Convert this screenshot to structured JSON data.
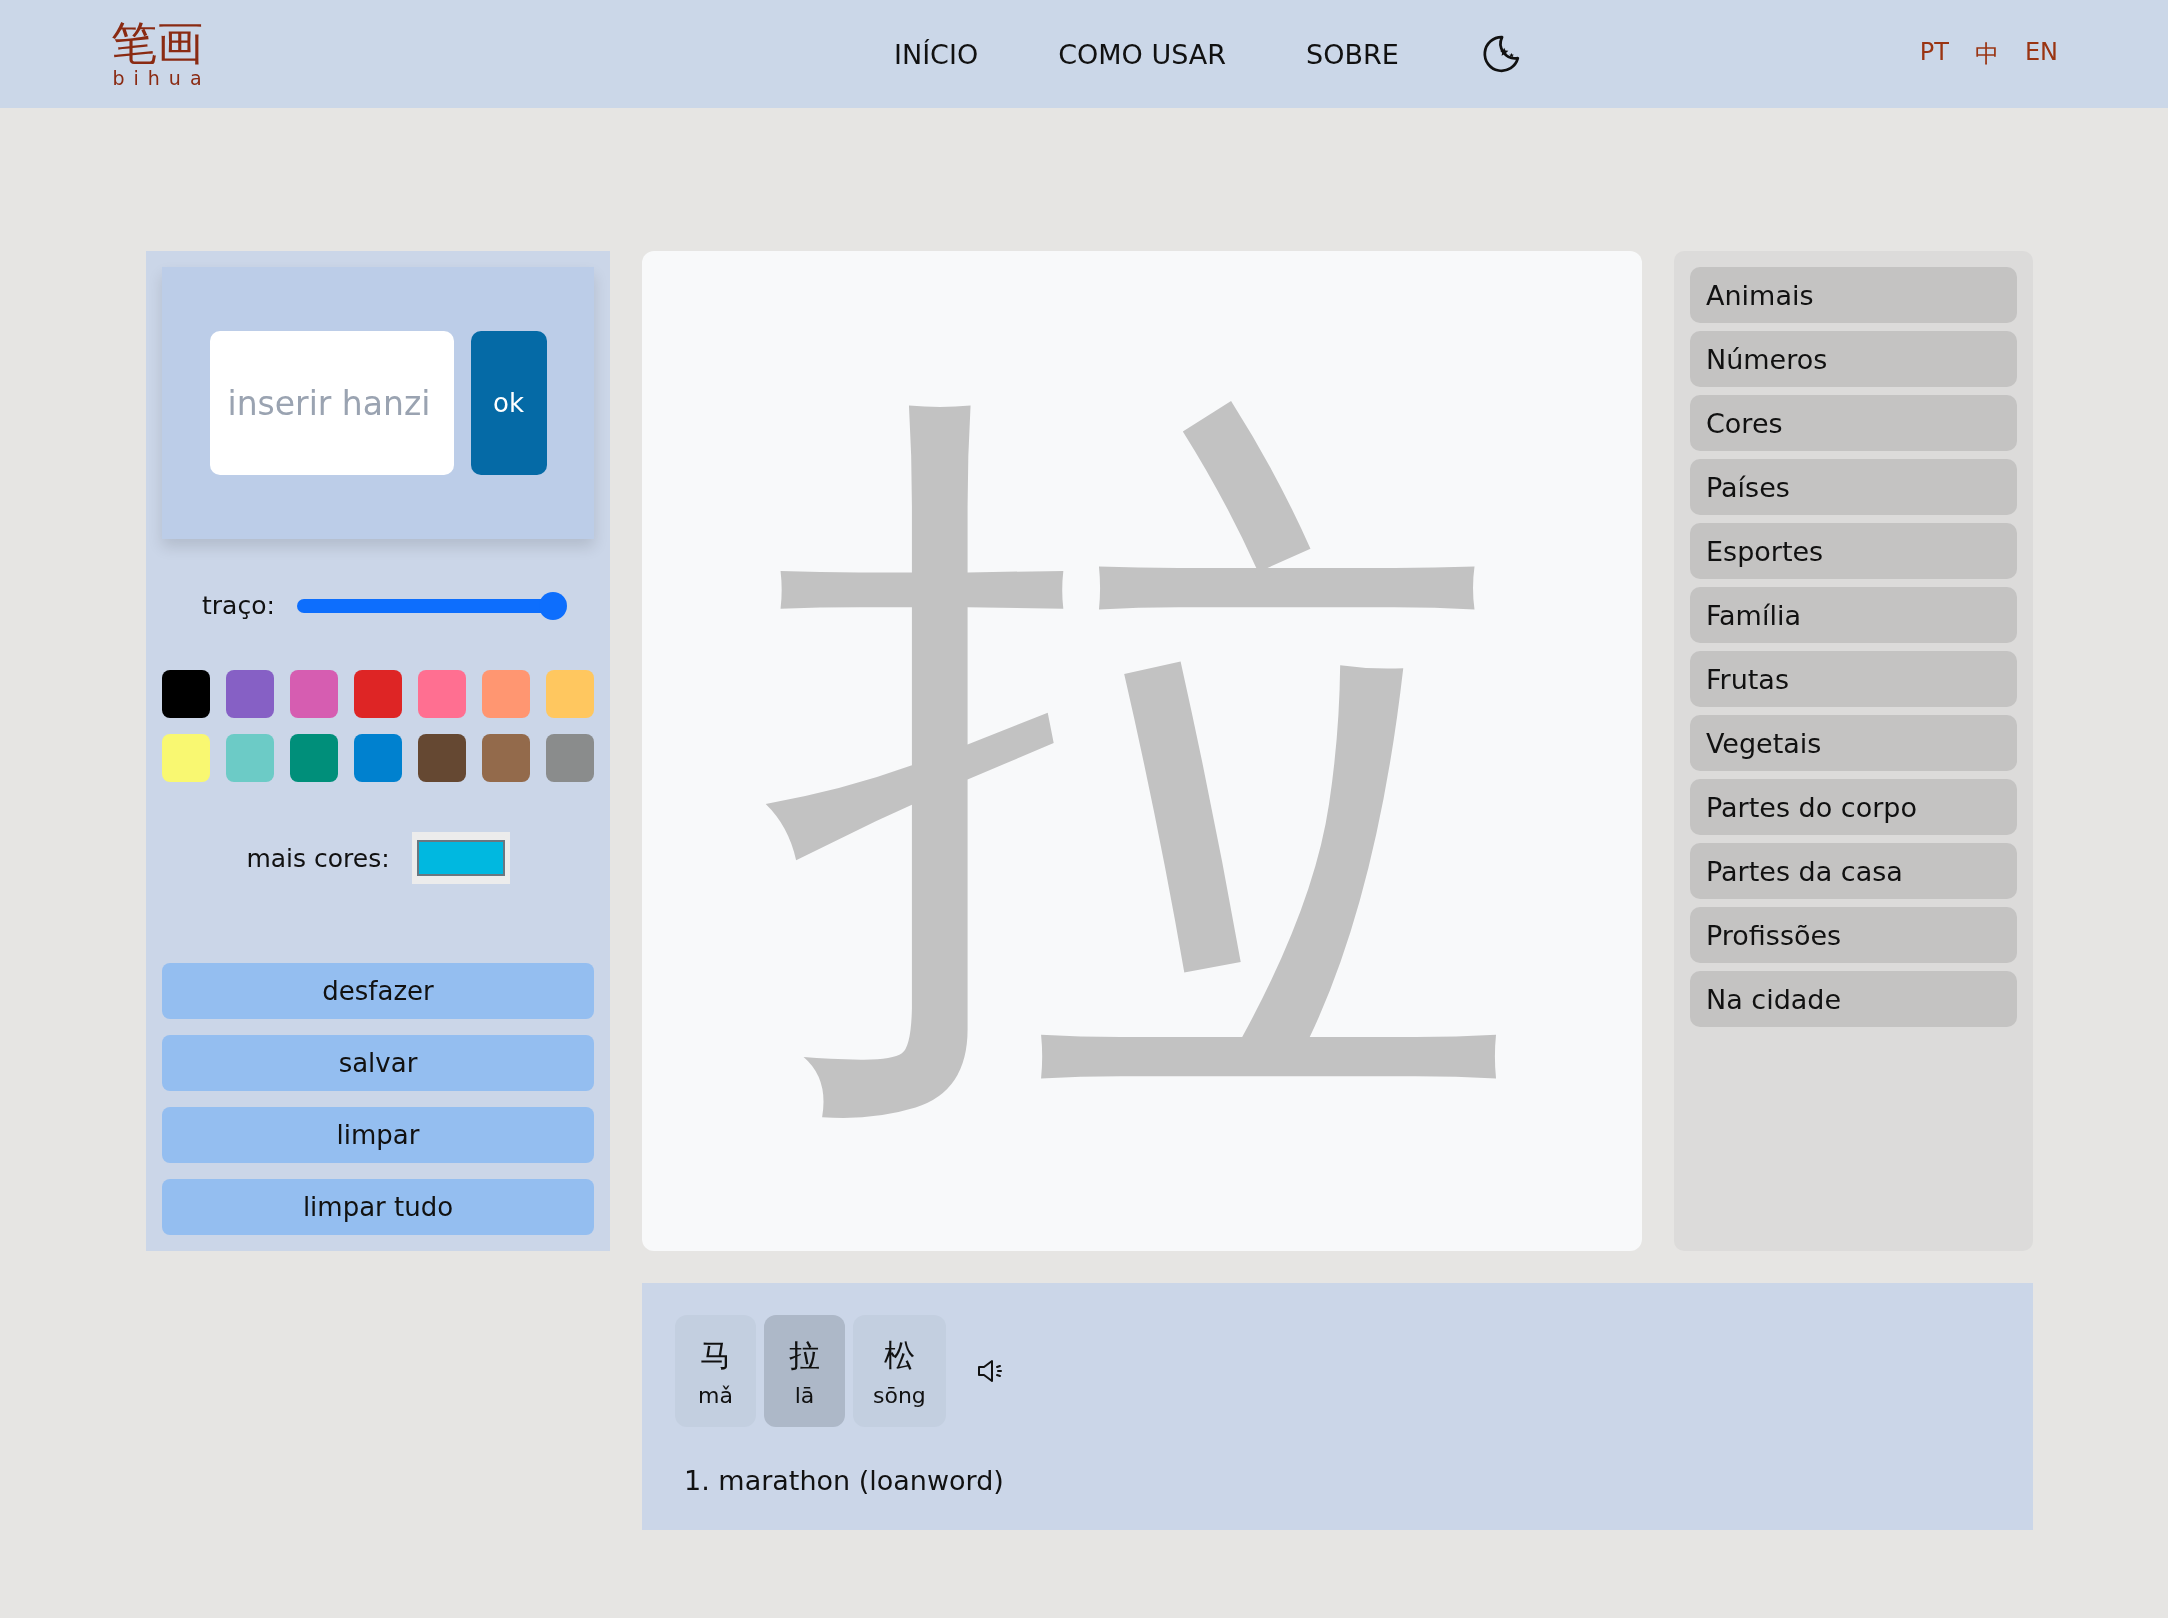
{
  "logo": {
    "hanzi": "笔画",
    "pinyin": "bihua"
  },
  "nav": [
    "INÍCIO",
    "COMO USAR",
    "SOBRE"
  ],
  "languages": [
    "PT",
    "中",
    "EN"
  ],
  "input": {
    "placeholder": "inserir hanzi",
    "button": "ok"
  },
  "stroke": {
    "label": "traço:",
    "level": 1.0
  },
  "colors": [
    {
      "color": "#000000"
    },
    {
      "color": "#8660c5"
    },
    {
      "color": "#d65db1"
    },
    {
      "color": "#de2525"
    },
    {
      "color": "#ff6f91"
    },
    {
      "color": "#ff9671"
    },
    {
      "color": "#ffc75f"
    },
    {
      "color": "#f9f871"
    },
    {
      "color": "#6ccbc6"
    },
    {
      "color": "#008f7a"
    },
    {
      "color": "#0081cf"
    },
    {
      "color": "#654832"
    },
    {
      "color": "#936a4b"
    },
    {
      "color": "#8a8c8c"
    }
  ],
  "more_colors": {
    "label": "mais cores:",
    "color": "#00b8e0"
  },
  "actions": [
    "desfazer",
    "salvar",
    "limpar",
    "limpar tudo"
  ],
  "canvas": {
    "character": "拉"
  },
  "categories": [
    "Animais",
    "Números",
    "Cores",
    "Países",
    "Esportes",
    "Família",
    "Frutas",
    "Vegetais",
    "Partes do corpo",
    "Partes da casa",
    "Profissões",
    "Na cidade"
  ],
  "syllables": [
    {
      "hanzi": "马",
      "pinyin": "mǎ",
      "selected": false
    },
    {
      "hanzi": "拉",
      "pinyin": "lā",
      "selected": true
    },
    {
      "hanzi": "松",
      "pinyin": "sōng",
      "selected": false
    }
  ],
  "definitions": [
    "1. marathon (loanword)"
  ]
}
